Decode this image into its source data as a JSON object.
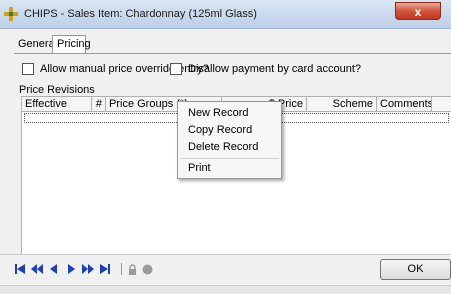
{
  "window": {
    "title": "CHIPS - Sales Item: Chardonnay (125ml Glass)",
    "close_label": "x"
  },
  "tabs": [
    {
      "label": "General"
    },
    {
      "label": "Pricing",
      "active": true
    }
  ],
  "options": {
    "manual_price": {
      "label": "Allow manual price override/entry?",
      "checked": false
    },
    "disallow_card": {
      "label": "Disallow payment by card account?",
      "checked": false
    }
  },
  "price_revisions": {
    "label": "Price Revisions",
    "columns": [
      "Effective",
      "#",
      "Price Groups (*)",
      "$ Price",
      "Scheme",
      "Comments"
    ],
    "rows": []
  },
  "context_menu": {
    "items": [
      "New Record",
      "Copy Record",
      "Delete Record",
      "Print"
    ]
  },
  "footer": {
    "ok_label": "OK"
  },
  "colors": {
    "nav_blue": "#1f3fb3",
    "title_gradient_top": "#dbe6f4",
    "close_red": "#c2381f"
  }
}
